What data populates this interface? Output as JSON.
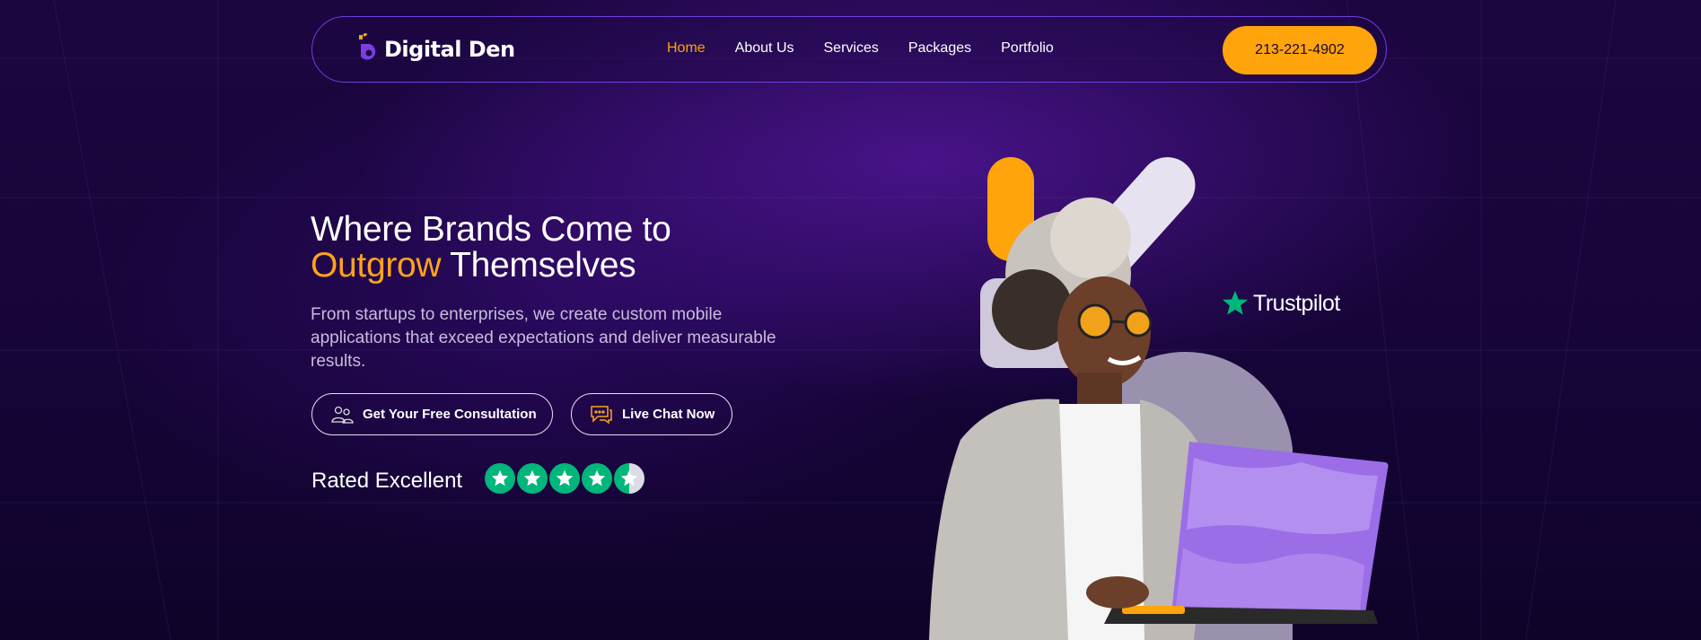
{
  "header": {
    "brand": "Digital Den",
    "nav": [
      {
        "label": "Home",
        "active": true
      },
      {
        "label": "About Us",
        "active": false
      },
      {
        "label": "Services",
        "active": false
      },
      {
        "label": "Packages",
        "active": false
      },
      {
        "label": "Portfolio",
        "active": false
      }
    ],
    "phone": "213-221-4902"
  },
  "hero": {
    "headline_line1": "Where Brands Come to",
    "headline_highlight": "Outgrow",
    "headline_rest": " Themselves",
    "subtext": "From startups to enterprises, we create custom mobile applications that exceed expectations and deliver measurable results.",
    "cta_consult": "Get Your Free Consultation",
    "cta_chat": "Live Chat Now",
    "rated_label": "Rated Excellent",
    "rating_stars": 4.5
  },
  "trustpilot_label": "Trustpilot",
  "colors": {
    "accent_orange": "#ffa40a",
    "brand_purple": "#7b3fe4",
    "trustpilot_green": "#00b67a"
  },
  "icons": {
    "consult": "consultation-people-icon",
    "chat": "chat-bubble-icon",
    "star": "star-icon"
  }
}
